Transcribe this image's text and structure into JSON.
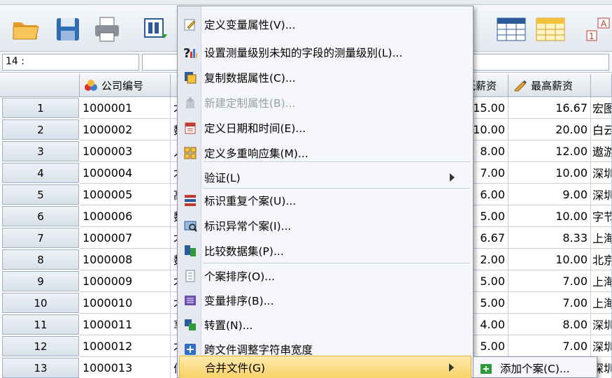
{
  "toolbar": {
    "icons": [
      "open-folder-icon",
      "save-icon",
      "print-icon",
      "recall-dialog-icon",
      "variables-icon",
      "grid-icon"
    ]
  },
  "cellrow": {
    "reference": "14 :"
  },
  "grid": {
    "headers": {
      "company_id": "公司编号",
      "min_salary": "低薪资",
      "max_salary": "最高薪资"
    },
    "rows": [
      {
        "n": "1",
        "id": "1000001",
        "c2": "才",
        "min": "15.00",
        "max": "16.67",
        "c5": "宏图"
      },
      {
        "n": "2",
        "id": "1000002",
        "c2": "数",
        "min": "10.00",
        "max": "20.00",
        "c5": "白云"
      },
      {
        "n": "3",
        "id": "1000003",
        "c2": "人",
        "min": "8.00",
        "max": "12.00",
        "c5": "遨游"
      },
      {
        "n": "4",
        "id": "1000004",
        "c2": "才",
        "min": "7.00",
        "max": "10.00",
        "c5": "深圳"
      },
      {
        "n": "5",
        "id": "1000005",
        "c2": "高",
        "min": "6.00",
        "max": "9.00",
        "c5": "深圳"
      },
      {
        "n": "6",
        "id": "1000006",
        "c2": "数",
        "min": "5.00",
        "max": "10.00",
        "c5": "字节"
      },
      {
        "n": "7",
        "id": "1000007",
        "c2": "才",
        "min": "6.67",
        "max": "8.33",
        "c5": "上海"
      },
      {
        "n": "8",
        "id": "1000008",
        "c2": "数",
        "min": "2.00",
        "max": "10.00",
        "c5": "北京"
      },
      {
        "n": "9",
        "id": "1000009",
        "c2": "才",
        "min": "5.00",
        "max": "7.00",
        "c5": "上海"
      },
      {
        "n": "10",
        "id": "1000010",
        "c2": "才",
        "min": "5.00",
        "max": "7.00",
        "c5": "上海"
      },
      {
        "n": "11",
        "id": "1000011",
        "c2": "享",
        "min": "4.00",
        "max": "8.00",
        "c5": "深圳"
      },
      {
        "n": "12",
        "id": "1000012",
        "c2": "才",
        "min": "5.00",
        "max": "7.00",
        "c5": "深圳"
      },
      {
        "n": "13",
        "id": "1000013",
        "c2": "信",
        "min": "5.00",
        "max": "7.00",
        "c5": "深圳"
      }
    ]
  },
  "data_menu": {
    "items": [
      {
        "label": "定义变量属性(V)...",
        "icon": "define-properties-icon"
      },
      {
        "label": "设置测量级别未知的字段的测量级别(L)...",
        "icon": "measure-level-icon"
      },
      {
        "label": "复制数据属性(C)...",
        "icon": "copy-properties-icon"
      },
      {
        "label": "新建定制属性(B)...",
        "icon": "custom-attribute-icon"
      },
      {
        "label": "定义日期和时间(E)...",
        "icon": "date-time-icon"
      },
      {
        "label": "定义多重响应集(M)...",
        "icon": "multiple-response-icon"
      },
      {
        "label": "验证(L)"
      },
      {
        "label": "标识重复个案(U)...",
        "icon": "duplicate-cases-icon"
      },
      {
        "label": "标识异常个案(I)...",
        "icon": "unusual-cases-icon"
      },
      {
        "label": "比较数据集(P)...",
        "icon": "compare-datasets-icon"
      },
      {
        "label": "个案排序(O)...",
        "icon": "sort-cases-icon"
      },
      {
        "label": "变量排序(B)...",
        "icon": "sort-variables-icon"
      },
      {
        "label": "转置(N)...",
        "icon": "transpose-icon"
      },
      {
        "label": "跨文件调整字符串宽度",
        "icon": "adjust-width-icon"
      },
      {
        "label": "合并文件(G)"
      }
    ]
  },
  "submenu": {
    "items": [
      {
        "label": "添加个案(C)...",
        "icon": "add-cases-icon"
      }
    ]
  }
}
